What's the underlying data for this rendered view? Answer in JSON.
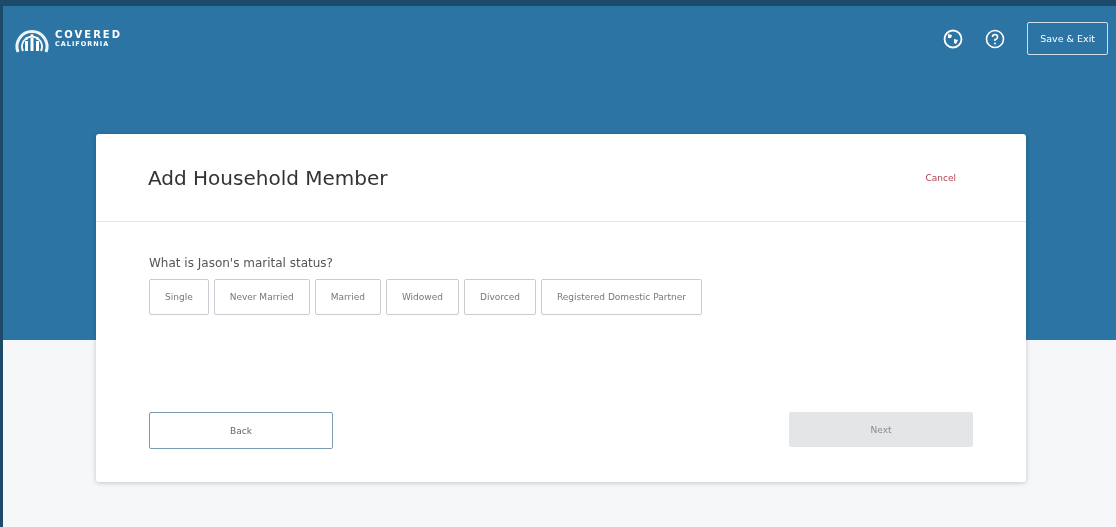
{
  "header": {
    "logo_line1": "COVERED",
    "logo_line2": "CALIFORNIA",
    "save_exit": "Save & Exit"
  },
  "card": {
    "title": "Add Household Member",
    "cancel": "Cancel",
    "question": "What is Jason's marital status?",
    "options": [
      {
        "label": "Single",
        "selected": false
      },
      {
        "label": "Never Married",
        "selected": false
      },
      {
        "label": "Married",
        "selected": false
      },
      {
        "label": "Widowed",
        "selected": false
      },
      {
        "label": "Divorced",
        "selected": false
      },
      {
        "label": "Registered Domestic Partner",
        "selected": false
      }
    ],
    "back": "Back",
    "next": {
      "label": "Next",
      "disabled": true
    }
  }
}
